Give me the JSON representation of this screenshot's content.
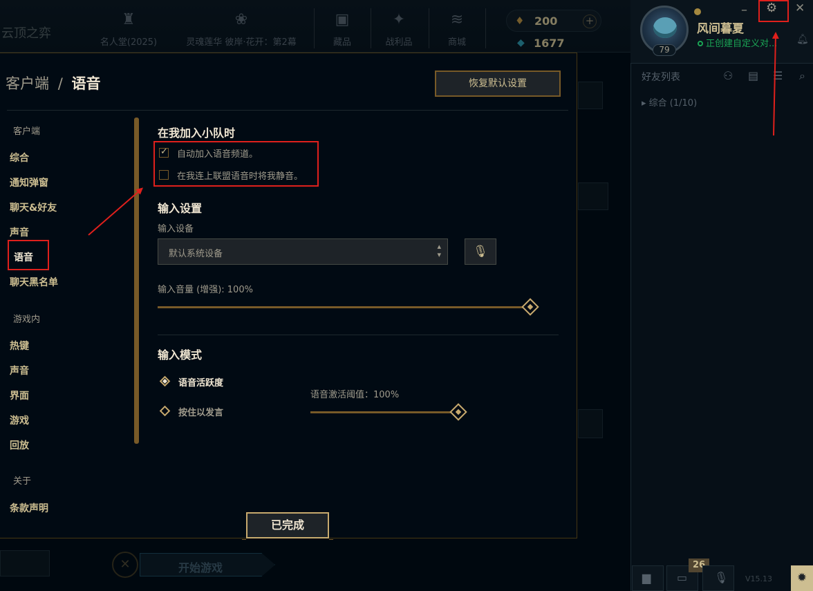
{
  "app": {
    "brand": "云顶之弈",
    "nav": [
      {
        "label": "名人堂(2025)",
        "icon": "crest-icon"
      },
      {
        "label": "灵魂莲华 彼岸·花开：第2幕",
        "icon": "lotus-icon"
      },
      {
        "label": "藏品",
        "icon": "bag-icon"
      },
      {
        "label": "战利品",
        "icon": "loot-icon"
      },
      {
        "label": "商城",
        "icon": "coins-icon"
      }
    ],
    "currency": {
      "rp": "200",
      "be": "1677",
      "add": "+"
    },
    "profile": {
      "name": "风间暮夏",
      "status": "正创建自定义对...",
      "level": "79",
      "status_color": "#1aa555"
    },
    "window": {
      "minimize": "–",
      "settings": "⚙",
      "close": "✕"
    },
    "friends": {
      "title": "好友列表",
      "group": "综合 (1/10)"
    },
    "play": {
      "label": "开始游戏",
      "cancel": "✕"
    },
    "bottom_badge": "26",
    "version": "V15.13"
  },
  "settings": {
    "breadcrumb_parent": "客户端",
    "breadcrumb_sep": "/",
    "breadcrumb_current": "语音",
    "restore_label": "恢复默认设置",
    "done_label": "已完成",
    "sidebar": {
      "group_client": "客户端",
      "client_items": [
        "综合",
        "通知弹窗",
        "聊天&好友",
        "声音",
        "语音",
        "聊天黑名单"
      ],
      "group_ingame": "游戏内",
      "ingame_items": [
        "热键",
        "声音",
        "界面",
        "游戏",
        "回放"
      ],
      "group_about": "关于",
      "about_items": [
        "条款声明"
      ]
    },
    "party_section": {
      "title": "在我加入小队时",
      "auto_join": {
        "label": "自动加入语音频道。",
        "checked": true
      },
      "mute_on_connect": {
        "label": "在我连上联盟语音时将我静音。",
        "checked": false
      }
    },
    "input_section": {
      "title": "输入设置",
      "device_label": "输入设备",
      "device_value": "默认系统设备",
      "volume_label": "输入音量 (增强): 100%",
      "volume_percent": 100
    },
    "mode_section": {
      "title": "输入模式",
      "voice_activity": {
        "label": "语音活跃度",
        "selected": true
      },
      "push_to_talk": {
        "label": "按住以发言",
        "selected": false
      },
      "threshold_label": "语音激活阈值：100%",
      "threshold_percent": 100
    }
  },
  "colors": {
    "gold": "#c8aa6e",
    "gold_dark": "#785a28",
    "text": "#a09b8c",
    "title": "#f0e6d2",
    "annotation": "#e0201c"
  }
}
